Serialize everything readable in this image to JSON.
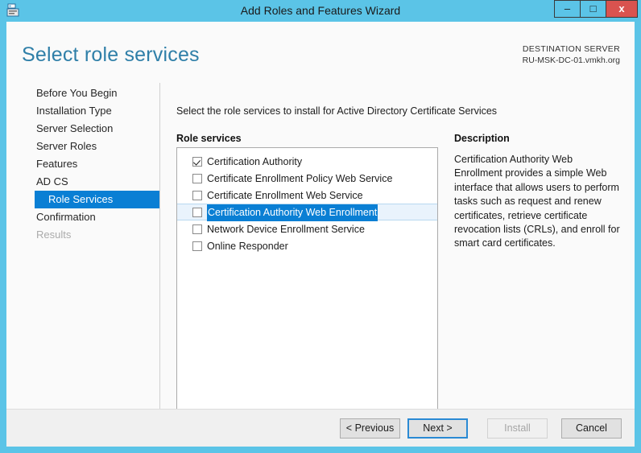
{
  "window": {
    "title": "Add Roles and Features Wizard",
    "icon": "wizard-server-icon",
    "minimize_label": "–",
    "maximize_label": "□",
    "close_label": "x",
    "border_color": "#5BC4E7"
  },
  "header": {
    "page_title": "Select role services",
    "destination_label": "DESTINATION SERVER",
    "destination_server": "RU-MSK-DC-01.vmkh.org",
    "title_color": "#2F7FA8"
  },
  "sidebar": {
    "selected_color": "#0A7FD4",
    "items": [
      {
        "label": "Before You Begin",
        "state": "normal"
      },
      {
        "label": "Installation Type",
        "state": "normal"
      },
      {
        "label": "Server Selection",
        "state": "normal"
      },
      {
        "label": "Server Roles",
        "state": "normal"
      },
      {
        "label": "Features",
        "state": "normal"
      },
      {
        "label": "AD CS",
        "state": "normal"
      },
      {
        "label": "Role Services",
        "state": "selected"
      },
      {
        "label": "Confirmation",
        "state": "normal"
      },
      {
        "label": "Results",
        "state": "disabled"
      }
    ]
  },
  "main": {
    "instruction": "Select the role services to install for Active Directory Certificate Services",
    "list_label": "Role services",
    "role_services": [
      {
        "label": "Certification Authority",
        "checked": true,
        "selected": false
      },
      {
        "label": "Certificate Enrollment Policy Web Service",
        "checked": false,
        "selected": false
      },
      {
        "label": "Certificate Enrollment Web Service",
        "checked": false,
        "selected": false
      },
      {
        "label": "Certification Authority Web Enrollment",
        "checked": false,
        "selected": true
      },
      {
        "label": "Network Device Enrollment Service",
        "checked": false,
        "selected": false
      },
      {
        "label": "Online Responder",
        "checked": false,
        "selected": false
      }
    ]
  },
  "description": {
    "title": "Description",
    "body": "Certification Authority Web Enrollment provides a simple Web interface that allows users to perform tasks such as request and renew certificates, retrieve certificate revocation lists (CRLs), and enroll for smart card certificates."
  },
  "footer": {
    "previous_label": "< Previous",
    "next_label": "Next >",
    "install_label": "Install",
    "cancel_label": "Cancel",
    "install_enabled": false,
    "focus_color": "#2A8AD4"
  }
}
